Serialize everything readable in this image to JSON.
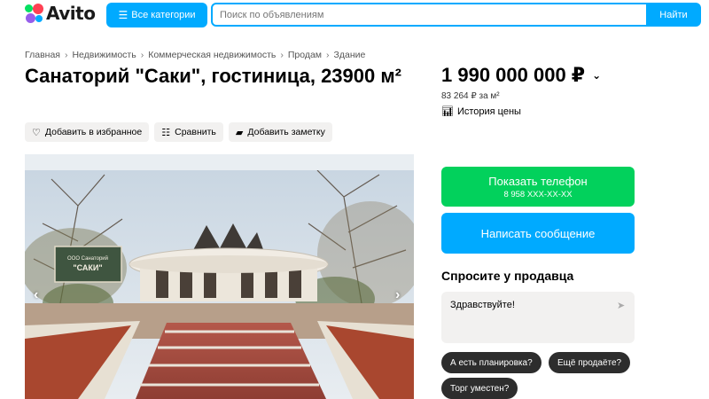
{
  "header": {
    "logo_text": "Avito",
    "categories_label": "Все категории",
    "search_placeholder": "Поиск по объявлениям",
    "search_button": "Найти"
  },
  "breadcrumb": [
    "Главная",
    "Недвижимость",
    "Коммерческая недвижимость",
    "Продам",
    "Здание"
  ],
  "listing": {
    "title": "Санаторий \"Саки\", гостиница, 23900 м²",
    "price": "1 990 000 000 ₽",
    "price_per_m": "83 264 ₽ за м²",
    "price_history": "История цены"
  },
  "actions": {
    "favorite": "Добавить в избранное",
    "compare": "Сравнить",
    "note": "Добавить заметку"
  },
  "photo": {
    "sign_line1": "ООО Санаторий",
    "sign_line2": "\"САКИ\""
  },
  "contact": {
    "show_phone": "Показать телефон",
    "phone_masked": "8 958 XXX-XX-XX",
    "write_message": "Написать сообщение"
  },
  "ask": {
    "title": "Спросите у продавца",
    "message_value": "Здравствуйте!",
    "chips": [
      "А есть планировка?",
      "Ещё продаёте?",
      "Торг уместен?"
    ]
  },
  "colors": {
    "accent": "#00aaff",
    "phone_green": "#02d15c",
    "chip_bg": "#2d2d2d"
  }
}
